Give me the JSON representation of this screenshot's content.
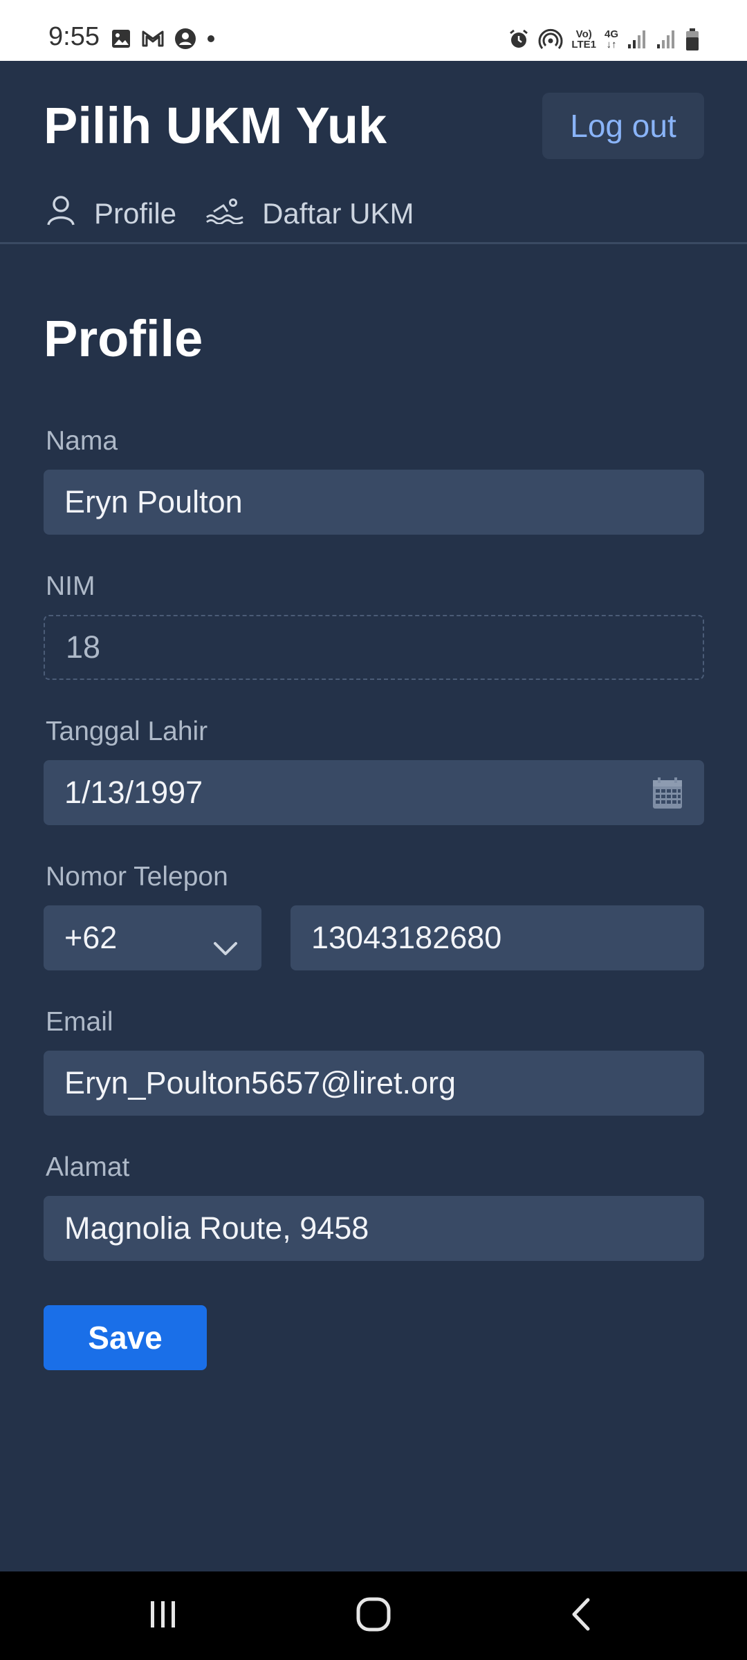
{
  "status_bar": {
    "time": "9:55",
    "network_top": "Vo)",
    "network_bottom": "LTE1",
    "network_type": "4G",
    "left_icons": [
      "gallery-icon",
      "gmail-icon",
      "account-icon",
      "dot-icon"
    ],
    "right_icons": [
      "alarm-icon",
      "hotspot-icon",
      "volte-icon",
      "4g-icon",
      "signal-icon",
      "signal-icon",
      "battery-icon"
    ]
  },
  "header": {
    "app_title": "Pilih UKM Yuk",
    "logout_label": "Log out"
  },
  "nav": {
    "items": [
      {
        "label": "Profile",
        "icon": "user-icon"
      },
      {
        "label": "Daftar UKM",
        "icon": "swimming-icon"
      }
    ]
  },
  "page": {
    "title": "Profile"
  },
  "form": {
    "nama_label": "Nama",
    "nama_value": "Eryn Poulton",
    "nim_label": "NIM",
    "nim_value": "18",
    "tanggal_lahir_label": "Tanggal Lahir",
    "tanggal_lahir_value": "1/13/1997",
    "nomor_telepon_label": "Nomor Telepon",
    "country_code": "+62",
    "phone_value": "13043182680",
    "email_label": "Email",
    "email_value": "Eryn_Poulton5657@liret.org",
    "alamat_label": "Alamat",
    "alamat_value": "Magnolia Route, 9458",
    "save_label": "Save"
  },
  "colors": {
    "background": "#243249",
    "input_bg": "#394a65",
    "primary": "#1a6fe8",
    "link": "#8ab4f8"
  }
}
